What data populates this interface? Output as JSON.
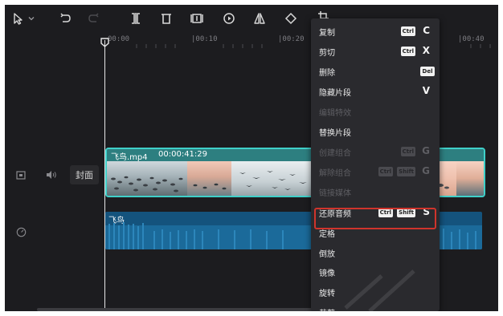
{
  "toolbar": {
    "icons": [
      "select-pointer-icon",
      "dropdown-chevron-icon",
      "undo-icon",
      "redo-icon",
      "split-icon",
      "delete-icon",
      "freeze-frame-icon",
      "reverse-play-icon",
      "mirror-icon",
      "rotate-icon",
      "crop-icon"
    ]
  },
  "ruler": {
    "ticks": [
      "00:00",
      "|00:10",
      "|00:20",
      "|00:40"
    ]
  },
  "tracks": {
    "cover_label": "封面",
    "video": {
      "clip_name": "飞鸟.mp4",
      "clip_duration": "00:00:41:29"
    },
    "audio": {
      "clip_name": "飞鸟"
    }
  },
  "context_menu": {
    "items": [
      {
        "label": "复制",
        "badges": [
          "Ctrl"
        ],
        "key": "C",
        "enabled": true
      },
      {
        "label": "剪切",
        "badges": [
          "Ctrl"
        ],
        "key": "X",
        "enabled": true
      },
      {
        "label": "删除",
        "badges": [
          "Del"
        ],
        "key": "",
        "enabled": true
      },
      {
        "label": "隐藏片段",
        "badges": [],
        "key": "V",
        "enabled": true
      },
      {
        "label": "编辑特效",
        "badges": [],
        "key": "",
        "enabled": false
      },
      {
        "label": "替换片段",
        "badges": [],
        "key": "",
        "enabled": true
      },
      {
        "label": "创建组合",
        "badges": [
          "Ctrl"
        ],
        "key": "G",
        "enabled": false
      },
      {
        "label": "解除组合",
        "badges": [
          "Ctrl",
          "Shift"
        ],
        "key": "G",
        "enabled": false
      },
      {
        "label": "链接媒体",
        "badges": [],
        "key": "",
        "enabled": false
      },
      {
        "label": "还原音频",
        "badges": [
          "Ctrl",
          "Shift"
        ],
        "key": "S",
        "enabled": true,
        "highlighted": true
      },
      {
        "label": "定格",
        "badges": [],
        "key": "",
        "enabled": true
      },
      {
        "label": "倒放",
        "badges": [],
        "key": "",
        "enabled": true
      },
      {
        "label": "镜像",
        "badges": [],
        "key": "",
        "enabled": true
      },
      {
        "label": "旋转",
        "badges": [],
        "key": "",
        "enabled": true
      },
      {
        "label": "裁剪",
        "badges": [],
        "key": "",
        "enabled": true
      }
    ]
  },
  "colors": {
    "timeline_bg": "#1c1c1f",
    "video_clip_border": "#3fd0c9",
    "audio_clip_bg": "#14537d",
    "highlight_border": "#d0342c"
  }
}
